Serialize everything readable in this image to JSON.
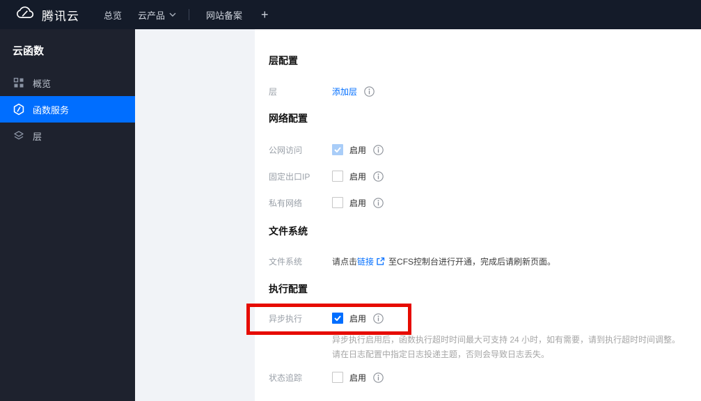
{
  "navbar": {
    "brand": "腾讯云",
    "overview": "总览",
    "cloud_products": "云产品",
    "website_record": "网站备案",
    "add_tab": "+"
  },
  "sidebar": {
    "title": "云函数",
    "overview": "概览",
    "function_service": "函数服务",
    "layers": "层"
  },
  "layer_config": {
    "heading": "层配置",
    "layer_label": "层",
    "add_layer_link": "添加层"
  },
  "network_config": {
    "heading": "网络配置",
    "public_access": {
      "label": "公网访问",
      "enable": "启用",
      "checked": true,
      "disabled": true
    },
    "fixed_egress_ip": {
      "label": "固定出口IP",
      "enable": "启用",
      "checked": false
    },
    "private_network": {
      "label": "私有网络",
      "enable": "启用",
      "checked": false
    }
  },
  "file_system": {
    "heading": "文件系统",
    "label": "文件系统",
    "text_before": "请点击",
    "link": "链接",
    "text_after": "至CFS控制台进行开通，完成后请刷新页面。"
  },
  "execution_config": {
    "heading": "执行配置",
    "async_execution": {
      "label": "异步执行",
      "enable": "启用",
      "checked": true
    },
    "help_line1": "异步执行启用后，函数执行超时时间最大可支持 24 小时，如有需要，请到执行超时时间调整。",
    "help_line2": "请在日志配置中指定日志投递主题，否则会导致日志丢失。",
    "status_trace": {
      "label": "状态追踪",
      "enable": "启用",
      "checked": false
    }
  },
  "colors": {
    "accent_blue": "#006eff",
    "annotation_red": "#e60b00",
    "disabled_checked_blue": "#a9cdf8",
    "navbar_bg": "#141b29",
    "sidebar_bg": "#1e222e",
    "subpanel_bg": "#f1f3f7"
  }
}
